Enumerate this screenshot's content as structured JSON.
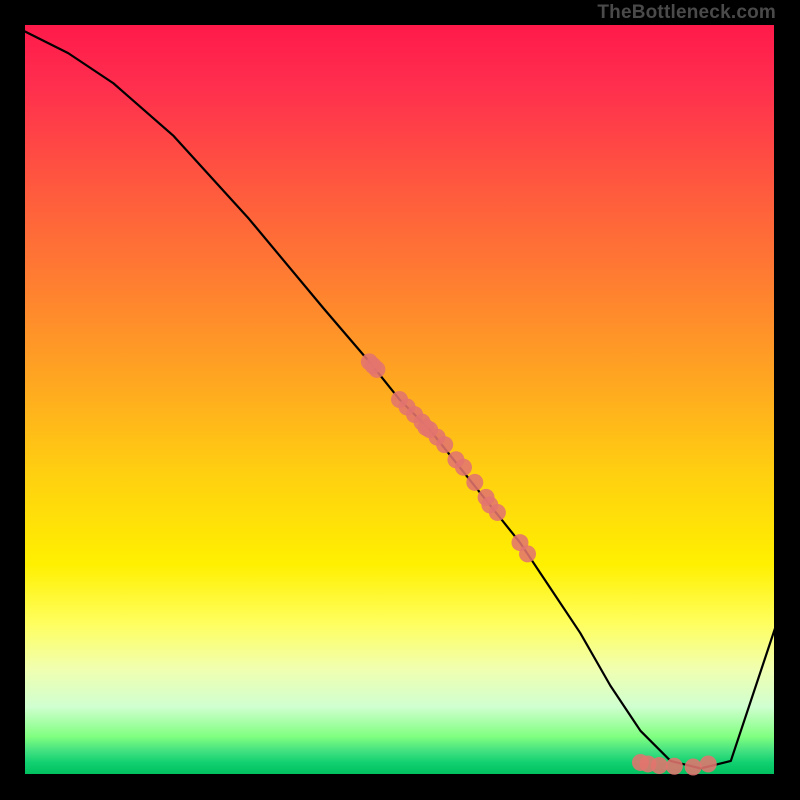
{
  "watermark": "TheBottleneck.com",
  "chart_data": {
    "type": "line",
    "title": "",
    "xlabel": "",
    "ylabel": "",
    "xlim": [
      0,
      100
    ],
    "ylim": [
      0,
      100
    ],
    "series": [
      {
        "name": "bottleneck-curve",
        "x": [
          0,
          6,
          12,
          20,
          30,
          40,
          46,
          50,
          54,
          58,
          62,
          66,
          70,
          74,
          78,
          82,
          86,
          90,
          94,
          100
        ],
        "y": [
          99,
          96,
          92,
          85,
          74,
          62,
          55,
          50,
          46,
          41,
          36,
          31,
          25,
          19,
          12,
          6,
          2,
          1,
          2,
          20
        ]
      }
    ],
    "markers": {
      "name": "data-points",
      "color": "#e2746e",
      "x": [
        46.0,
        47.0,
        46.5,
        50.0,
        51.0,
        52.0,
        53.0,
        54.0,
        53.5,
        55.0,
        56.0,
        57.5,
        58.5,
        60.0,
        61.5,
        62.0,
        63.0,
        66.0,
        67.0,
        82.0,
        83.0,
        84.5,
        86.5,
        89.0,
        91.0
      ],
      "y": [
        55.0,
        54.0,
        54.5,
        50.0,
        49.0,
        48.0,
        47.0,
        46.0,
        46.3,
        45.0,
        44.0,
        42.0,
        41.0,
        39.0,
        37.0,
        36.0,
        35.0,
        31.0,
        29.5,
        1.8,
        1.6,
        1.4,
        1.3,
        1.2,
        1.6
      ]
    }
  }
}
